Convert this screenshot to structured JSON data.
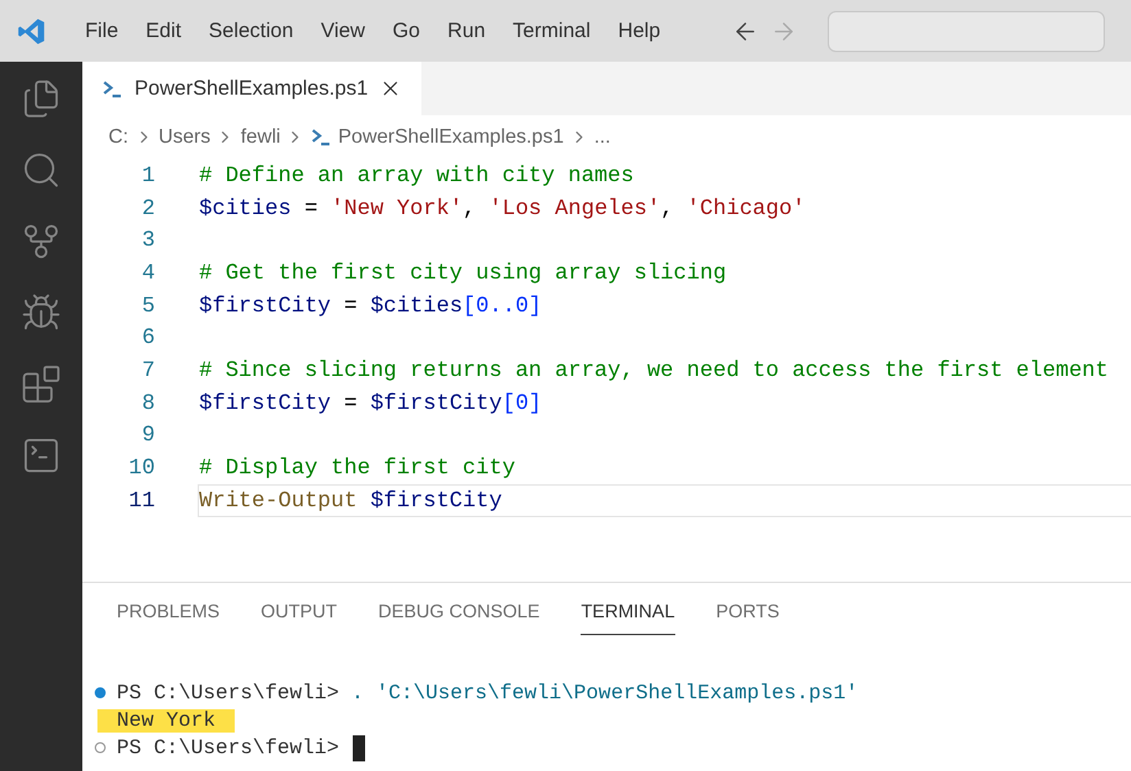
{
  "menu": [
    "File",
    "Edit",
    "Selection",
    "View",
    "Go",
    "Run",
    "Terminal",
    "Help"
  ],
  "nav": [
    {
      "kind": "back",
      "disabled": false
    },
    {
      "kind": "forward",
      "disabled": true
    }
  ],
  "activity_bar": [
    {
      "kind": "files"
    },
    {
      "kind": "search"
    },
    {
      "kind": "source-control"
    },
    {
      "kind": "run"
    },
    {
      "kind": "extensions"
    },
    {
      "kind": "terminal"
    }
  ],
  "editor_tabs": [
    {
      "label": "PowerShellExamples.ps1",
      "selected": true
    }
  ],
  "breadcrumb": [
    {
      "label": "C:",
      "kind": "text"
    },
    {
      "label": "Users",
      "kind": "text"
    },
    {
      "label": "fewli",
      "kind": "text"
    },
    {
      "label": "PowerShellExamples.ps1",
      "kind": "file"
    },
    {
      "label": "...",
      "kind": "text"
    }
  ],
  "code_lines": [
    {
      "number": "1",
      "current": false,
      "tokens": [
        {
          "kind": "comment",
          "text": "# Define an array with city names"
        }
      ]
    },
    {
      "number": "2",
      "current": false,
      "tokens": [
        {
          "kind": "variable",
          "text": "$cities"
        },
        {
          "kind": "plain",
          "text": " = "
        },
        {
          "kind": "string",
          "text": "'New York'"
        },
        {
          "kind": "plain",
          "text": ", "
        },
        {
          "kind": "string",
          "text": "'Los Angeles'"
        },
        {
          "kind": "plain",
          "text": ", "
        },
        {
          "kind": "string",
          "text": "'Chicago'"
        }
      ]
    },
    {
      "number": "3",
      "current": false
    },
    {
      "number": "4",
      "current": false,
      "tokens": [
        {
          "kind": "comment",
          "text": "# Get the first city using array slicing"
        }
      ]
    },
    {
      "number": "5",
      "current": false,
      "tokens": [
        {
          "kind": "variable",
          "text": "$firstCity"
        },
        {
          "kind": "plain",
          "text": " = "
        },
        {
          "kind": "variable",
          "text": "$cities"
        },
        {
          "kind": "bracket",
          "text": "[0..0]"
        }
      ]
    },
    {
      "number": "6",
      "current": false
    },
    {
      "number": "7",
      "current": false,
      "tokens": [
        {
          "kind": "comment",
          "text": "# Since slicing returns an array, we need to access the first element"
        }
      ]
    },
    {
      "number": "8",
      "current": false,
      "tokens": [
        {
          "kind": "variable",
          "text": "$firstCity"
        },
        {
          "kind": "plain",
          "text": " = "
        },
        {
          "kind": "variable",
          "text": "$firstCity"
        },
        {
          "kind": "bracket",
          "text": "[0]"
        }
      ]
    },
    {
      "number": "9",
      "current": false
    },
    {
      "number": "10",
      "current": false,
      "tokens": [
        {
          "kind": "comment",
          "text": "# Display the first city"
        }
      ]
    },
    {
      "number": "11",
      "current": true,
      "tokens": [
        {
          "kind": "command",
          "text": "Write-Output"
        },
        {
          "kind": "variable",
          "text": " $firstCity"
        }
      ]
    }
  ],
  "panel_tabs": [
    {
      "label": "PROBLEMS",
      "selected": false
    },
    {
      "label": "OUTPUT",
      "selected": false
    },
    {
      "label": "DEBUG CONSOLE",
      "selected": false
    },
    {
      "label": "TERMINAL",
      "selected": true
    },
    {
      "label": "PORTS",
      "selected": false
    }
  ],
  "terminal_lines": [
    {
      "kind": "command",
      "succeeded": true,
      "prompt": "PS C:\\Users\\fewli>",
      "command": ". 'C:\\Users\\fewli\\PowerShellExamples.ps1'",
      "cursor": false
    },
    {
      "kind": "output",
      "text": "New York",
      "highlighted": true
    },
    {
      "kind": "command",
      "succeeded": false,
      "prompt": "PS C:\\Users\\fewli>",
      "cursor": true
    }
  ]
}
